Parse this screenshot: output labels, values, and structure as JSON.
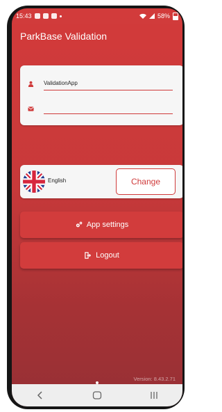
{
  "status_bar": {
    "time": "15:43",
    "battery": "58%"
  },
  "app_bar": {
    "title": "ParkBase Validation"
  },
  "login": {
    "username_value": "ValidationApp",
    "email_value": ""
  },
  "language": {
    "name": "English",
    "change_label": "Change"
  },
  "buttons": {
    "app_settings": "App settings",
    "logout": "Logout"
  },
  "footer": {
    "version": "Version: 8.43.2.71"
  },
  "colors": {
    "accent": "#d13a3a",
    "card": "#f6f6f6"
  }
}
